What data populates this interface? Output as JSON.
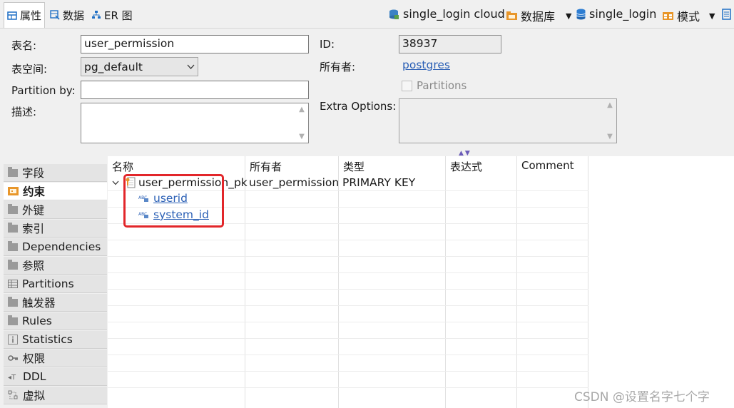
{
  "tabs": [
    {
      "label": "属性",
      "icon": "properties-icon"
    },
    {
      "label": "数据",
      "icon": "data-icon"
    },
    {
      "label": "ER 图",
      "icon": "er-diagram-icon"
    }
  ],
  "breadcrumb": {
    "connection": "single_login cloud",
    "catalog": "数据库",
    "database": "single_login",
    "schema": "模式"
  },
  "props": {
    "table_name_label": "表名:",
    "table_name": "user_permission",
    "tablespace_label": "表空间:",
    "tablespace": "pg_default",
    "partition_by_label": "Partition by:",
    "partition_by": "",
    "description_label": "描述:",
    "id_label": "ID:",
    "id": "38937",
    "owner_label": "所有者:",
    "owner": "postgres",
    "partitions_label": "Partitions",
    "extra_options_label": "Extra Options:"
  },
  "sidebar": {
    "items": [
      {
        "label": "字段",
        "icon": "folder-icon"
      },
      {
        "label": "约束",
        "icon": "constraint-icon"
      },
      {
        "label": "外键",
        "icon": "folder-icon"
      },
      {
        "label": "索引",
        "icon": "folder-icon"
      },
      {
        "label": "Dependencies",
        "icon": "folder-icon"
      },
      {
        "label": "参照",
        "icon": "folder-icon"
      },
      {
        "label": "Partitions",
        "icon": "partitions-icon"
      },
      {
        "label": "触发器",
        "icon": "folder-icon"
      },
      {
        "label": "Rules",
        "icon": "folder-icon"
      },
      {
        "label": "Statistics",
        "icon": "info-icon"
      },
      {
        "label": "权限",
        "icon": "key-icon"
      },
      {
        "label": "DDL",
        "icon": "ddl-icon"
      },
      {
        "label": "虚拟",
        "icon": "virtual-icon"
      }
    ],
    "active_index": 1
  },
  "grid": {
    "headers": [
      "名称",
      "所有者",
      "类型",
      "表达式",
      "Comment"
    ],
    "row": {
      "name": "user_permission_pk",
      "owner": "user_permission",
      "type": "PRIMARY KEY",
      "expression": "",
      "comment": ""
    },
    "children": [
      "userid",
      "system_id"
    ]
  },
  "watermark": "CSDN @设置名字七个字",
  "colors": {
    "highlight": "#e2262a",
    "link": "#2a5fb5"
  }
}
